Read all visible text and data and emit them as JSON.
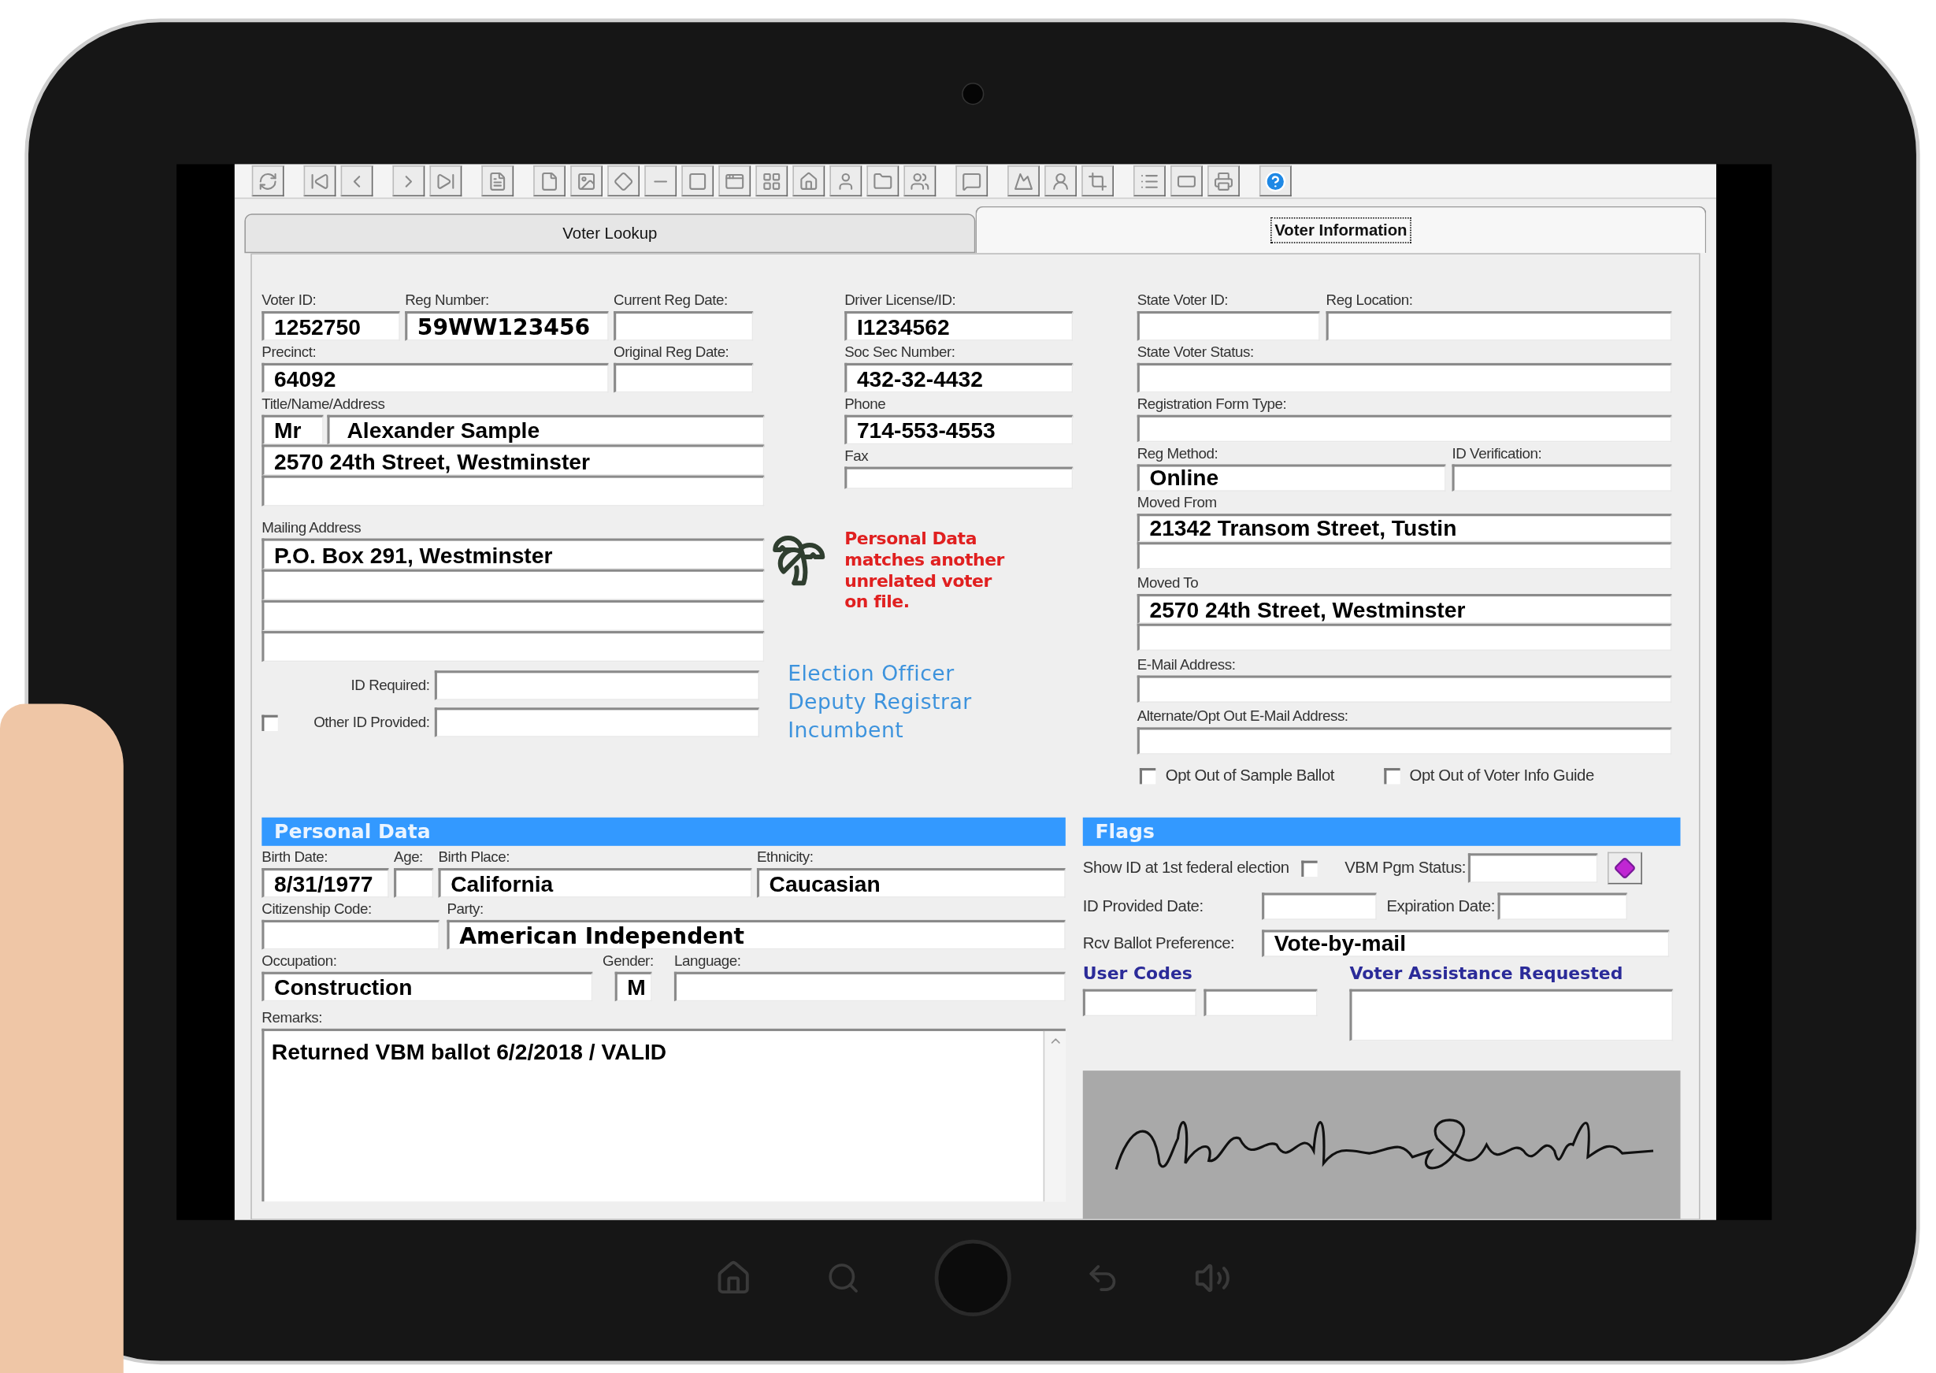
{
  "tabs": [
    {
      "label": "Voter Lookup",
      "selected": false
    },
    {
      "label": "Voter Information",
      "selected": true
    }
  ],
  "left": {
    "voter_id": {
      "label": "Voter ID:",
      "value": "1252750"
    },
    "reg_number": {
      "label": "Reg Number:",
      "value": "59WW123456"
    },
    "current_reg_date": {
      "label": "Current Reg Date:"
    },
    "precinct": {
      "label": "Precinct:",
      "value": "64092"
    },
    "original_reg_date": {
      "label": "Original Reg Date:"
    },
    "name_label": "Title/Name/Address",
    "title": "Mr",
    "name": "Alexander Sample",
    "address_lines": [
      "2570 24th Street, Westminster"
    ],
    "mailing_label": "Mailing Address",
    "mailing_lines": [
      "P.O. Box 291, Westminster"
    ],
    "id_required": {
      "label": "ID Required:"
    },
    "other_id_provided": {
      "label": "Other ID Provided:",
      "checked": false
    }
  },
  "middle": {
    "driver_license": {
      "label": "Driver License/ID:",
      "value": "I1234562"
    },
    "ssn": {
      "label": "Soc Sec Number:",
      "value": "432-32-4432"
    },
    "phone": {
      "label": "Phone",
      "value": "714-553-4553"
    },
    "fax": {
      "label": "Fax"
    },
    "alert": "Personal Data matches another unrelated voter on file.",
    "roles": [
      "Election Officer",
      "Deputy Registrar",
      "Incumbent"
    ]
  },
  "right": {
    "state_voter_id": {
      "label": "State Voter ID:"
    },
    "reg_location": {
      "label": "Reg Location:"
    },
    "state_voter_status": {
      "label": "State Voter Status:"
    },
    "registration_form_type": {
      "label": "Registration Form Type:"
    },
    "reg_method": {
      "label": "Reg Method:",
      "value": "Online"
    },
    "id_verification": {
      "label": "ID Verification:"
    },
    "moved_from": {
      "label": "Moved From",
      "value": "21342 Transom Street, Tustin"
    },
    "moved_to": {
      "label": "Moved To",
      "value": "2570 24th Street, Westminster"
    },
    "email": {
      "label": "E-Mail Address:"
    },
    "alternate_email": {
      "label": "Alternate/Opt Out E-Mail Address:"
    },
    "opt_outs": [
      {
        "label": "Opt Out of Sample Ballot",
        "checked": false
      },
      {
        "label": "Opt Out of Voter Info Guide",
        "checked": false
      }
    ]
  },
  "personal_data": {
    "title": "Personal Data",
    "birth_date": {
      "label": "Birth Date:",
      "value": "8/31/1977"
    },
    "age": {
      "label": "Age:"
    },
    "birth_place": {
      "label": "Birth Place:",
      "value": "California"
    },
    "ethnicity": {
      "label": "Ethnicity:",
      "value": "Caucasian"
    },
    "citizenship_code": {
      "label": "Citizenship Code:"
    },
    "party": {
      "label": "Party:",
      "value": "American Independent"
    },
    "occupation": {
      "label": "Occupation:",
      "value": "Construction"
    },
    "gender": {
      "label": "Gender:",
      "value": "M"
    },
    "language": {
      "label": "Language:"
    },
    "remarks": {
      "label": "Remarks:",
      "value": "Returned VBM ballot 6/2/2018 / VALID"
    }
  },
  "flags": {
    "title": "Flags",
    "show_id_first_federal": {
      "label": "Show ID at 1st federal election",
      "checked": false
    },
    "vbm_pgm_status": {
      "label": "VBM Pgm Status:"
    },
    "id_provided_date": {
      "label": "ID Provided Date:"
    },
    "expiration_date": {
      "label": "Expiration Date:"
    },
    "rcv_ballot_preference": {
      "label": "Rcv Ballot Preference:",
      "value": "Vote-by-mail"
    },
    "user_codes_label": "User Codes",
    "voter_assistance_label": "Voter Assistance Requested"
  }
}
